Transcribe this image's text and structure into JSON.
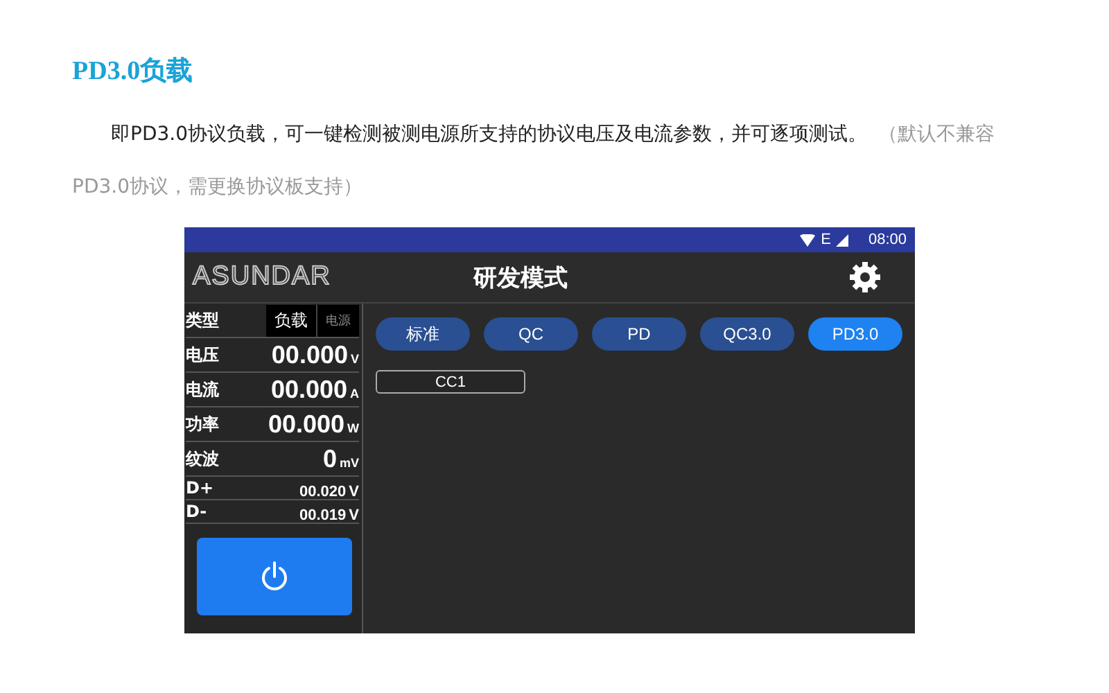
{
  "heading": "PD3.0负载",
  "paragraph": {
    "text": "即PD3.0协议负载，可一键检测被测电源所支持的协议电压及电流参数，并可逐项测试。",
    "note": "（默认不兼容PD3.0协议，需更换协议板支持）"
  },
  "app": {
    "status_bar": {
      "network": "E",
      "time": "08:00"
    },
    "header": {
      "logo": "ASUNDAR",
      "title": "研发模式"
    },
    "type_row": {
      "label": "类型",
      "options": [
        {
          "label": "负载",
          "selected": true
        },
        {
          "label": "电源",
          "selected": false
        }
      ]
    },
    "readings": [
      {
        "kind": "large",
        "label": "电压",
        "value": "00.000",
        "unit": "V"
      },
      {
        "kind": "large",
        "label": "电流",
        "value": "00.000",
        "unit": "A"
      },
      {
        "kind": "large",
        "label": "功率",
        "value": "00.000",
        "unit": "W"
      },
      {
        "kind": "large",
        "label": "纹波",
        "value": "0",
        "unit": "mV"
      },
      {
        "kind": "small",
        "label": "D+",
        "value": "00.020",
        "unit": "V"
      },
      {
        "kind": "small",
        "label": "D-",
        "value": "00.019",
        "unit": "V"
      }
    ],
    "modes": [
      {
        "label": "标准",
        "selected": false
      },
      {
        "label": "QC",
        "selected": false
      },
      {
        "label": "PD",
        "selected": false
      },
      {
        "label": "QC3.0",
        "selected": false
      },
      {
        "label": "PD3.0",
        "selected": true
      }
    ],
    "channels": [
      {
        "label": "CC1"
      }
    ]
  }
}
